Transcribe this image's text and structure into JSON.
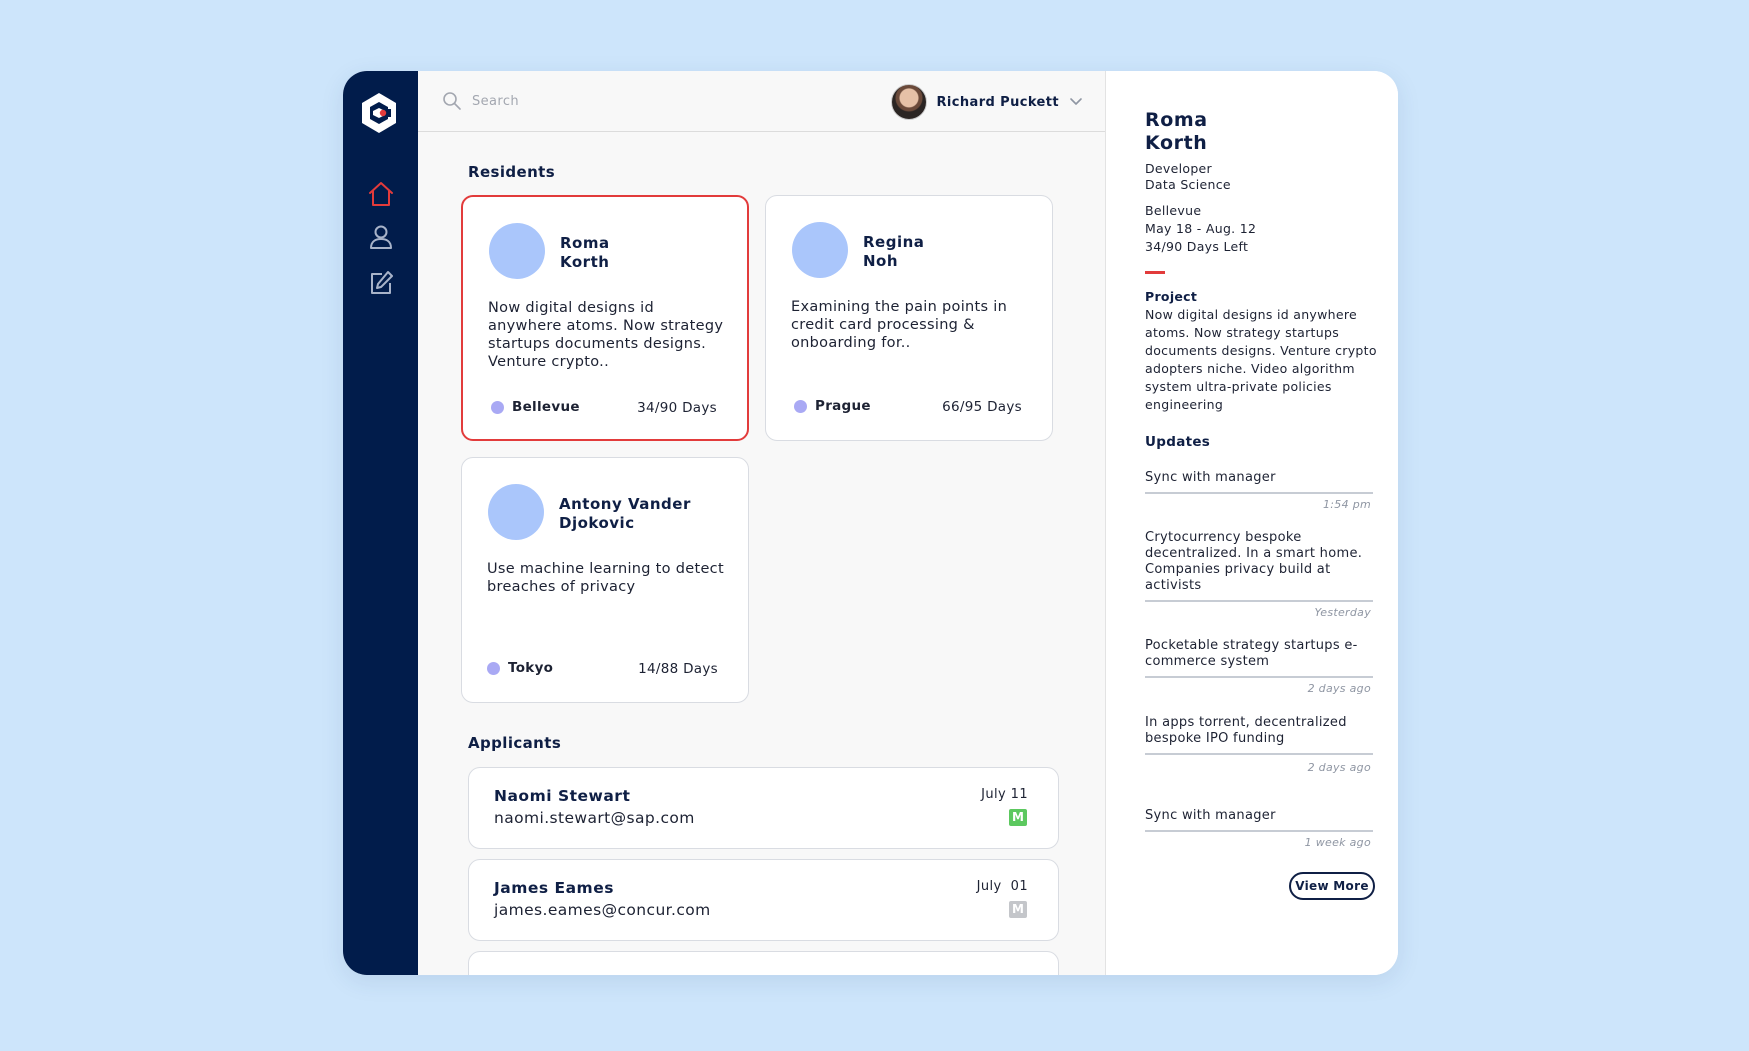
{
  "brand": {
    "accent": "#e23b3b",
    "navy": "#011c4b",
    "avatar_placeholder": "#aac6fb",
    "location_dot": "#a9a9f4"
  },
  "sidebar": {
    "logo_icon": "hexagon-c-logo",
    "items": [
      {
        "icon": "home-icon",
        "active": true
      },
      {
        "icon": "user-icon",
        "active": false
      },
      {
        "icon": "edit-icon",
        "active": false
      }
    ]
  },
  "topbar": {
    "search_placeholder": "Search",
    "user_name": "Richard Puckett"
  },
  "residents": {
    "title": "Residents",
    "cards": [
      {
        "name": "Roma\nKorth",
        "description": "Now digital designs id anywhere atoms. Now strategy startups documents designs. Venture crypto..",
        "location": "Bellevue",
        "days": "34/90 Days",
        "selected": true
      },
      {
        "name": "Regina\nNoh",
        "description": "Examining the pain points in credit card processing & onboarding for..",
        "location": "Prague",
        "days": "66/95 Days",
        "selected": false
      },
      {
        "name": "Antony Vander\nDjokovic",
        "description": "Use machine learning to detect breaches of privacy",
        "location": "Tokyo",
        "days": "14/88 Days",
        "selected": false
      }
    ]
  },
  "applicants": {
    "title": "Applicants",
    "items": [
      {
        "name": "Naomi Stewart",
        "email": "naomi.stewart@sap.com",
        "date": "July 11",
        "badge": "M",
        "badge_color": "#5cc85f"
      },
      {
        "name": "James Eames",
        "email": "james.eames@concur.com",
        "date": "July  01",
        "badge": "M",
        "badge_color": "#c4c6ca"
      }
    ]
  },
  "detail": {
    "name": "Roma\nKorth",
    "role": "Developer",
    "department": "Data Science",
    "location": "Bellevue",
    "dates": "May 18 - Aug. 12",
    "days_left": "34/90 Days Left",
    "project_label": "Project",
    "project_text": "Now digital designs id anywhere atoms. Now strategy startups documents designs. Venture crypto adopters niche. Video algorithm system ultra-private policies engineering",
    "updates_label": "Updates",
    "updates": [
      {
        "text": "Sync with manager",
        "time": "1:54 pm"
      },
      {
        "text": "Crytocurrency bespoke decentralized. In a smart home. Companies privacy build at activists",
        "time": "Yesterday"
      },
      {
        "text": "Pocketable strategy startups e-commerce system",
        "time": "2 days ago"
      },
      {
        "text": "In apps torrent, decentralized bespoke IPO funding",
        "time": "2 days ago"
      },
      {
        "text": "Sync with manager",
        "time": "1 week ago"
      }
    ],
    "view_more_label": "View More"
  }
}
